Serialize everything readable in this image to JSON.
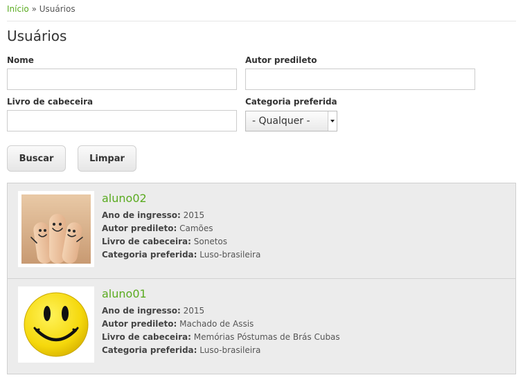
{
  "breadcrumb": {
    "home": "Início",
    "separator": " » ",
    "current": "Usuários"
  },
  "page_title": "Usuários",
  "filters": {
    "nome_label": "Nome",
    "nome_value": "",
    "autor_label": "Autor predileto",
    "autor_value": "",
    "livro_label": "Livro de cabeceira",
    "livro_value": "",
    "categoria_label": "Categoria preferida",
    "categoria_value": "- Qualquer -"
  },
  "buttons": {
    "buscar": "Buscar",
    "limpar": "Limpar"
  },
  "field_labels": {
    "ano": "Ano de ingresso:",
    "autor": "Autor predileto:",
    "livro": "Livro de cabeceira:",
    "categoria": "Categoria preferida:"
  },
  "users": [
    {
      "name": "aluno02",
      "ano": "2015",
      "autor": "Camões",
      "livro": "Sonetos",
      "categoria": "Luso-brasileira",
      "avatar": "fingers-smileys-photo"
    },
    {
      "name": "aluno01",
      "ano": "2015",
      "autor": "Machado de Assis",
      "livro": "Memórias Póstumas de Brás Cubas",
      "categoria": "Luso-brasileira",
      "avatar": "yellow-smiley-face"
    }
  ],
  "colors": {
    "link": "#5aab20",
    "panel": "#ececec",
    "text": "#333333"
  }
}
